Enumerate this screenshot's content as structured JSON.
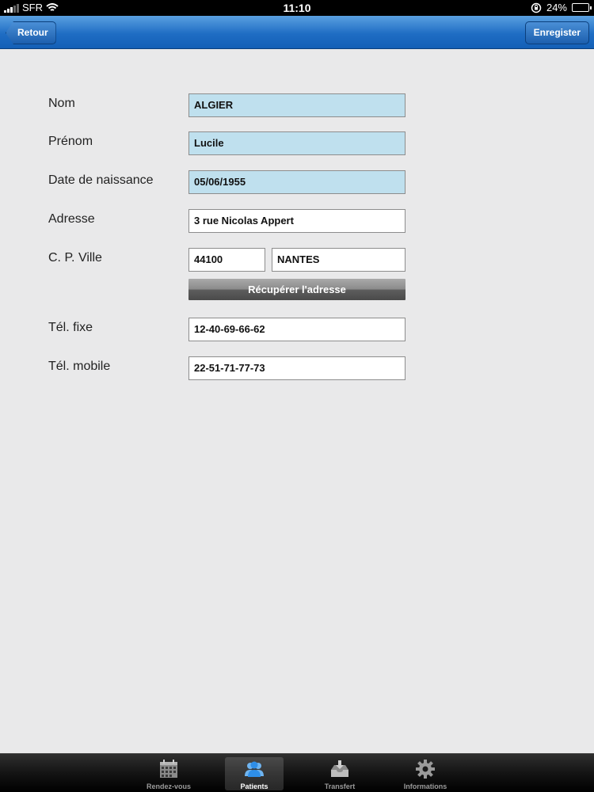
{
  "status_bar": {
    "carrier": "SFR",
    "time": "11:10",
    "battery": "24%",
    "battery_level": 0.24
  },
  "nav": {
    "back_label": "Retour",
    "save_label": "Enregister"
  },
  "form": {
    "nom": {
      "label": "Nom",
      "value": "ALGIER"
    },
    "prenom": {
      "label": "Prénom",
      "value": "Lucile"
    },
    "naissance": {
      "label": "Date de naissance",
      "value": "05/06/1955"
    },
    "adresse": {
      "label": "Adresse",
      "value": "3 rue Nicolas Appert"
    },
    "cp_ville": {
      "label": "C. P. Ville",
      "cp_value": "44100",
      "ville_value": "NANTES"
    },
    "recuperer_label": "Récupérer l'adresse",
    "tel_fixe": {
      "label": "Tél. fixe",
      "value": "12-40-69-66-62"
    },
    "tel_mobile": {
      "label": "Tél. mobile",
      "value": "22-51-71-77-73"
    }
  },
  "tabs": [
    {
      "label": "Rendez-vous",
      "icon": "calendar-icon",
      "active": false
    },
    {
      "label": "Patients",
      "icon": "patients-icon",
      "active": true
    },
    {
      "label": "Transfert",
      "icon": "transfer-icon",
      "active": false
    },
    {
      "label": "Informations",
      "icon": "gear-icon",
      "active": false
    }
  ],
  "colors": {
    "nav_blue": "#1f6dc4",
    "locked_field": "#bfe0ee",
    "background": "#e9e9ea"
  }
}
